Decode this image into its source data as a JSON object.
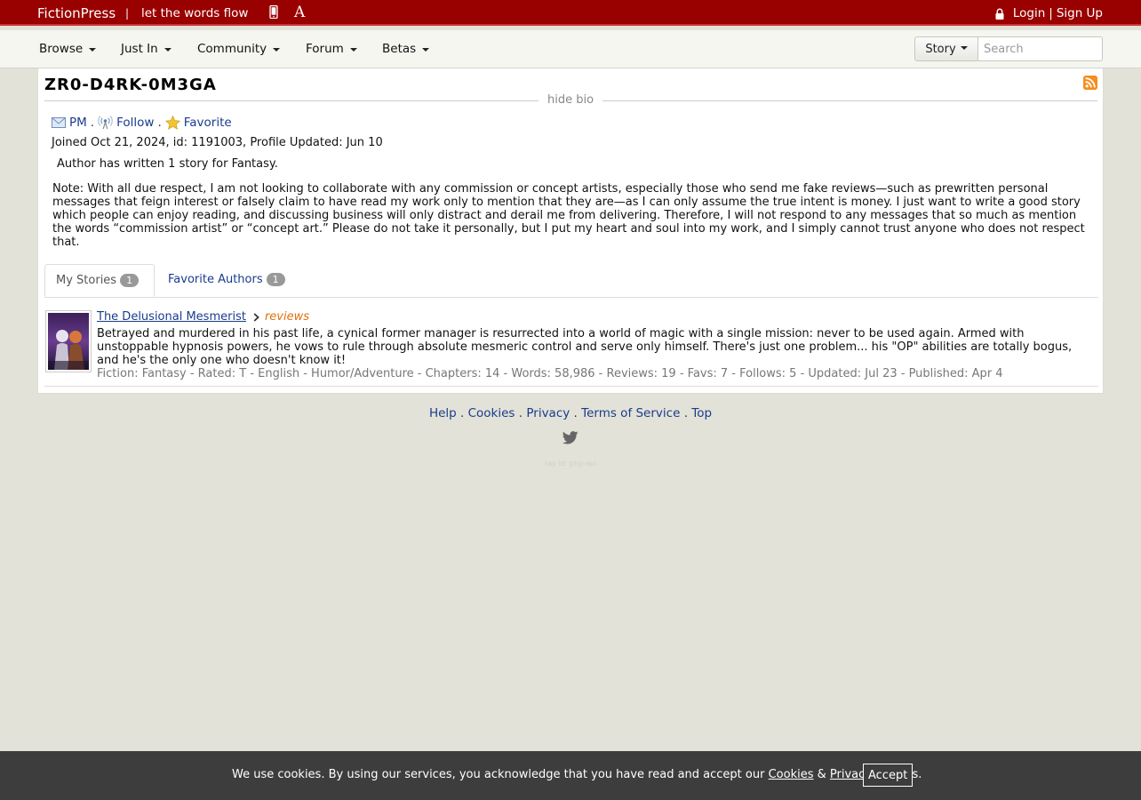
{
  "topbar": {
    "site_name": "FictionPress",
    "separator": "|",
    "tagline": "let the words flow",
    "font_glyph": "A",
    "login": "Login",
    "login_sep": "|",
    "signup": "Sign Up"
  },
  "nav": {
    "items": [
      {
        "label": "Browse"
      },
      {
        "label": "Just In"
      },
      {
        "label": "Community"
      },
      {
        "label": "Forum"
      },
      {
        "label": "Betas"
      }
    ],
    "search_type": "Story",
    "search_placeholder": "Search"
  },
  "profile": {
    "name": "ZR0-D4RK-0M3GA",
    "hide_bio": "hide bio",
    "actions": {
      "pm": "PM",
      "follow": "Follow",
      "favorite": "Favorite",
      "sep": "."
    },
    "joined": "Joined Oct 21, 2024, id: 1191003, Profile Updated: Jun 10",
    "written": "Author has written 1 story for Fantasy.",
    "note": "Note: With all due respect, I am not looking to collaborate with any commission or concept artists, especially those who send me fake reviews—such as prewritten personal messages that feign interest or falsely claim to have read my work only to mention that they are—as I can only assume the true intent is money. I just want to write a good story which people can enjoy reading, and discussing business will only distract and derail me from delivering. Therefore, I will not respond to any messages that so much as mention the words “commission artist” or “concept art.” Please do not take it personally, but I put my heart and soul into my work, and I simply cannot trust anyone who does not respect that."
  },
  "tabs": [
    {
      "label": "My Stories",
      "count": "1"
    },
    {
      "label": "Favorite Authors",
      "count": "1"
    }
  ],
  "story": {
    "title": "The Delusional Mesmerist",
    "reviews": "reviews",
    "summary": "Betrayed and murdered in his past life, a cynical former manager is resurrected into a world of magic with a single mission: never to be used again. Armed with unstoppable hypnosis powers, he vows to rule through absolute mesmeric control and serve only himself. There's just one problem... his \"OP\" abilities are totally bogus, and he's the only one who doesn't know it!",
    "meta": "Fiction: Fantasy - Rated: T - English - Humor/Adventure - Chapters: 14 - Words: 58,986 - Reviews: 19 - Favs: 7 - Follows: 5 - Updated: Jul 23 - Published: Apr 4"
  },
  "footer": {
    "links": [
      "Help",
      "Cookies",
      "Privacy",
      "Terms of Service",
      "Top"
    ],
    "sep": ".",
    "ray_id": "ray id: php-api"
  },
  "cookie": {
    "text_before": "We use cookies. By using our services, you acknowledge that you have read and accept our",
    "cookies_link": "Cookies",
    "amp": "&",
    "privacy_link": "Privacy",
    "text_after": "Policies.",
    "accept": "Accept"
  },
  "colors": {
    "topbar": "#990000",
    "link": "#1a3c8c",
    "reviews": "#e0700c",
    "background": "#e3e2d8",
    "cookie_bar": "#3d3d3d"
  }
}
